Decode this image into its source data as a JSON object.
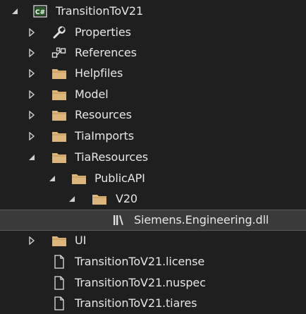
{
  "explorer": {
    "items": [
      {
        "label": "TransitionToV21",
        "icon": "csharp-project-icon",
        "expanded": true
      },
      {
        "label": "Properties",
        "icon": "wrench-icon",
        "expanded": false
      },
      {
        "label": "References",
        "icon": "references-icon",
        "expanded": false
      },
      {
        "label": "Helpfiles",
        "icon": "folder-icon",
        "expanded": false
      },
      {
        "label": "Model",
        "icon": "folder-icon",
        "expanded": false
      },
      {
        "label": "Resources",
        "icon": "folder-icon",
        "expanded": false
      },
      {
        "label": "TiaImports",
        "icon": "folder-icon",
        "expanded": false
      },
      {
        "label": "TiaResources",
        "icon": "folder-icon",
        "expanded": true
      },
      {
        "label": "PublicAPI",
        "icon": "folder-icon",
        "expanded": true
      },
      {
        "label": "V20",
        "icon": "folder-icon",
        "expanded": true
      },
      {
        "label": "Siemens.Engineering.dll",
        "icon": "assembly-reference-icon",
        "selected": true
      },
      {
        "label": "UI",
        "icon": "folder-icon",
        "expanded": false
      },
      {
        "label": "TransitionToV21.license",
        "icon": "file-icon"
      },
      {
        "label": "TransitionToV21.nuspec",
        "icon": "file-icon"
      },
      {
        "label": "TransitionToV21.tiares",
        "icon": "file-icon"
      }
    ]
  },
  "colors": {
    "background": "#1f1f1f",
    "selected_row": "#3a3a3a",
    "folder": "#dcb67a",
    "text": "#e6e6e6",
    "project_icon": "#4ec94e"
  }
}
